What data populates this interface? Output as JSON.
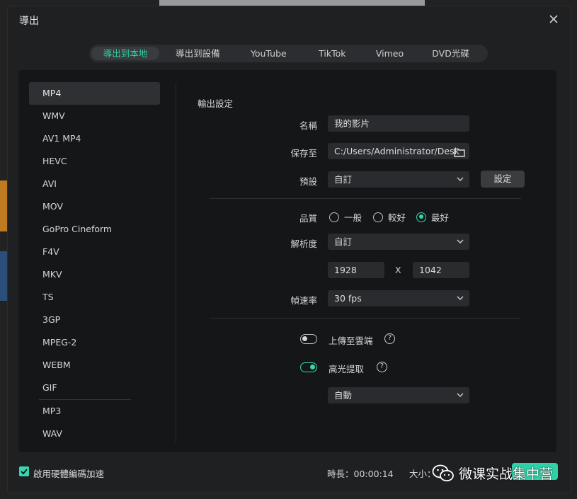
{
  "window": {
    "title": "導出"
  },
  "tabs": [
    {
      "label": "導出到本地",
      "active": true
    },
    {
      "label": "導出到設備",
      "active": false
    },
    {
      "label": "YouTube",
      "active": false
    },
    {
      "label": "TikTok",
      "active": false
    },
    {
      "label": "Vimeo",
      "active": false
    },
    {
      "label": "DVD光碟",
      "active": false
    }
  ],
  "formats": [
    "MP4",
    "WMV",
    "AV1 MP4",
    "HEVC",
    "AVI",
    "MOV",
    "GoPro Cineform",
    "F4V",
    "MKV",
    "TS",
    "3GP",
    "MPEG-2",
    "WEBM",
    "GIF",
    "MP3",
    "WAV"
  ],
  "selected_format": "MP4",
  "output": {
    "section_title": "輸出設定",
    "name_label": "名稱",
    "name_value": "我的影片",
    "save_label": "保存至",
    "save_value": "C:/Users/Administrator/Desk",
    "preset_label": "預設",
    "preset_value": "自訂",
    "settings_button": "設定",
    "quality_label": "品質",
    "quality_options": [
      "一般",
      "較好",
      "最好"
    ],
    "quality_selected": "最好",
    "resolution_label": "解析度",
    "resolution_value": "自訂",
    "width": "1928",
    "x_mark": "X",
    "height": "1042",
    "framerate_label": "幀速率",
    "framerate_value": "30 fps",
    "upload_label": "上傳至雲端",
    "upload_on": false,
    "highlight_label": "高光提取",
    "highlight_on": true,
    "highlight_mode": "自動",
    "help_glyph": "?"
  },
  "footer": {
    "hw_accel_label": "啟用硬體編碼加速",
    "hw_accel_checked": true,
    "duration": "時長：00:00:14",
    "size": "大小："
  },
  "watermark": {
    "text": "微课实战集中营"
  },
  "colors": {
    "accent": "#35d8ae",
    "panel": "#151617",
    "dialog": "#1f2022"
  }
}
